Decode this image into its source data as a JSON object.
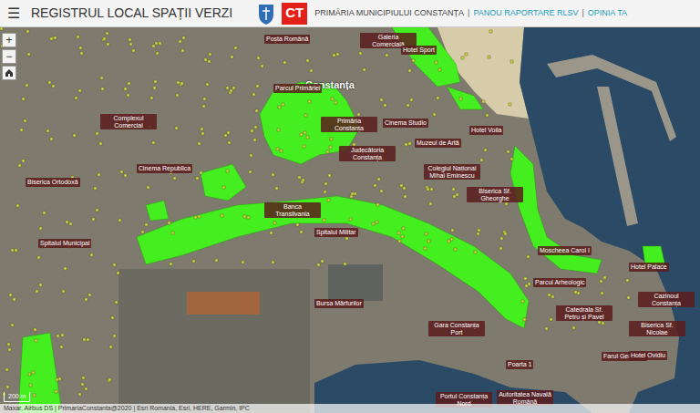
{
  "header": {
    "menu_icon": "☰",
    "title": "REGISTRUL LOCAL SPAȚII VERZI",
    "logo_text": "CT",
    "separator": "|",
    "links": [
      {
        "label": "PRIMĂRIA MUNICIPIULUI CONSTANȚA",
        "kind": "plain"
      },
      {
        "label": "PANOU RAPORTARE RLSV",
        "kind": "link"
      },
      {
        "label": "OPINIA TA",
        "kind": "link"
      }
    ]
  },
  "map": {
    "zoom_controls": [
      "+",
      "−"
    ],
    "city_label": "Constanța",
    "labels": [
      "Poșta Română",
      "Galeria Comercială",
      "Hotel Sport",
      "Parcul Primăriei",
      "Primăria Constanța",
      "Cinema Studio",
      "Muzeul de Artă",
      "Hotel Voila",
      "Judecătoria Constanța",
      "Colegiul Național Mihai Eminescu",
      "Biserica Sf. Gheorghe",
      "Banca Transilvania",
      "Spitalul Militar",
      "Complexul Comercial",
      "Cinema Republica",
      "Biserica Ortodoxă",
      "Spitalul Municipal",
      "Moscheea Carol I",
      "Catedrala Sf. Petru și Pavel",
      "Cazinoul Constanța",
      "Hotel Palace",
      "Biserica Sf. Nicolae",
      "Farul Genovez",
      "Gara Constanța Port",
      "Poarta 1",
      "Portul Constanța Nord",
      "Autoritatea Navală Română",
      "Bursa Mărfurilor",
      "Parcul Arheologic",
      "Hotel Ovidiu"
    ],
    "scale": "200 m",
    "attribution": "Maxar, Airbus DS | PrimariaConstanta@2020 | Esri Romania, Esri, HERE, Garmin, IPC"
  }
}
